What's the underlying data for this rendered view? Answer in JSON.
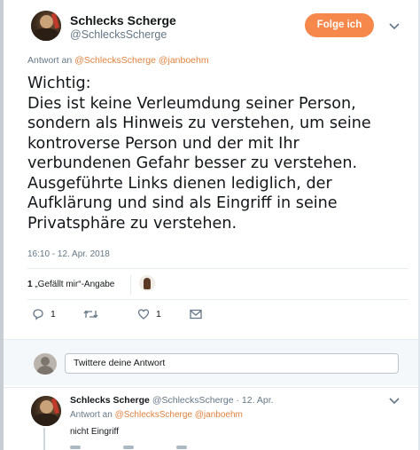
{
  "tweet": {
    "display_name": "Schlecks Scherge",
    "handle": "@SchlecksScherge",
    "follow_label": "Folge ich",
    "reply_to_prefix": "Antwort an",
    "reply_to_mentions": "@SchlecksScherge @janboehm",
    "text_lines": [
      "Wichtig:",
      "Dies ist keine Verleumdung seiner Person,",
      "sondern als Hinweis zu verstehen, um seine",
      "kontroverse Person und der mit Ihr",
      "verbundenen Gefahr besser zu verstehen.",
      "Ausgeführte Links dienen lediglich, der",
      "Aufklärung und sind als Eingriff in seine",
      "Privatsphäre zu verstehen."
    ],
    "timestamp": "16:10 - 12. Apr. 2018",
    "likes_count": "1",
    "likes_label": "„Gefällt mir“-Angabe",
    "actions": {
      "reply_count": "1",
      "retweet_count": "",
      "like_count": "1"
    }
  },
  "composer": {
    "placeholder": "Twittere deine Antwort"
  },
  "reply": {
    "display_name": "Schlecks Scherge",
    "meta": "@SchlecksScherge · 12. Apr.",
    "reply_to_prefix": "Antwort an",
    "reply_to_mentions": "@SchlecksScherge @janboehm",
    "text": "nicht Eingriff"
  },
  "colors": {
    "accent": "#f5884a",
    "mention": "#e0823d",
    "muted": "#657786"
  }
}
